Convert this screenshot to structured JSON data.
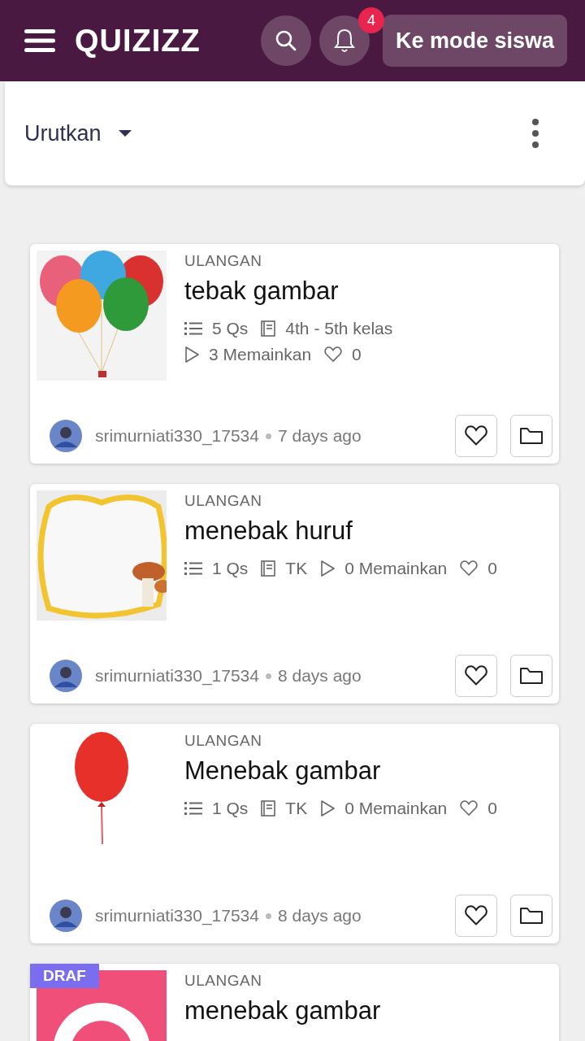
{
  "header": {
    "logo": "QUIZIZZ",
    "notifications": "4",
    "student_mode_button": "Ke mode siswa"
  },
  "sort_bar": {
    "label": "Urutkan"
  },
  "quizzes": [
    {
      "type": "ULANGAN",
      "title": "tebak gambar",
      "draft": false,
      "meta": [
        [
          {
            "kind": "questions",
            "text": "5 Qs"
          },
          {
            "kind": "grade",
            "text": "4th - 5th kelas"
          }
        ],
        [
          {
            "kind": "plays",
            "text": "3 Memainkan"
          },
          {
            "kind": "likes",
            "text": "0"
          }
        ]
      ],
      "author": "srimurniati330_17534",
      "age": "7 days ago"
    },
    {
      "type": "ULANGAN",
      "title": "menebak huruf",
      "draft": false,
      "meta": [
        [
          {
            "kind": "questions",
            "text": "1 Qs"
          },
          {
            "kind": "grade",
            "text": "TK"
          },
          {
            "kind": "plays",
            "text": "0 Memainkan"
          },
          {
            "kind": "likes",
            "text": "0"
          }
        ]
      ],
      "author": "srimurniati330_17534",
      "age": "8 days ago"
    },
    {
      "type": "ULANGAN",
      "title": "Menebak gambar",
      "draft": false,
      "meta": [
        [
          {
            "kind": "questions",
            "text": "1 Qs"
          },
          {
            "kind": "grade",
            "text": "TK"
          },
          {
            "kind": "plays",
            "text": "0 Memainkan"
          },
          {
            "kind": "likes",
            "text": "0"
          }
        ]
      ],
      "author": "srimurniati330_17534",
      "age": "8 days ago"
    },
    {
      "type": "ULANGAN",
      "title": "menebak gambar",
      "draft": true,
      "draft_label": "DRAF"
    }
  ]
}
